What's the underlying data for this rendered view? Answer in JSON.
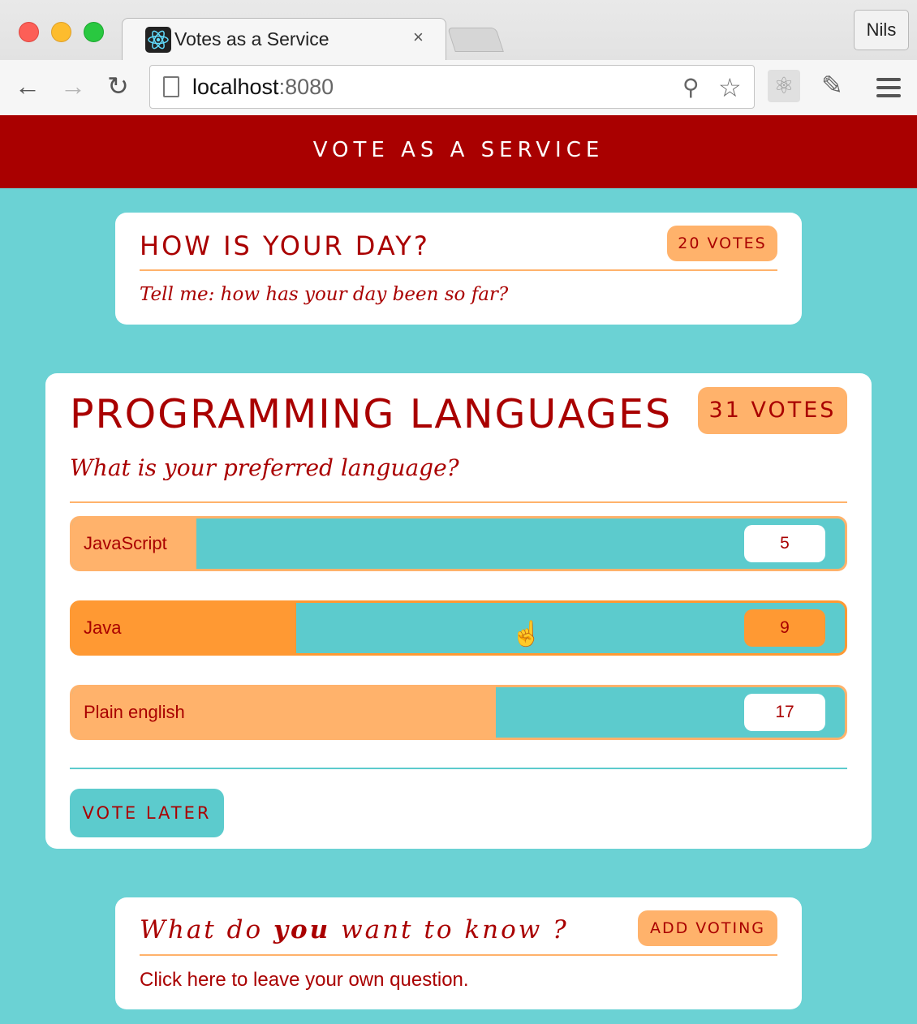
{
  "browser": {
    "tab_title": "Votes as a Service",
    "tab_close": "×",
    "profile": "Nils",
    "url_host": "localhost",
    "url_port": ":8080",
    "icons": [
      "back-icon",
      "forward-icon",
      "reload-icon",
      "page-icon",
      "zoom-icon",
      "star-icon",
      "react-devtools-icon",
      "color-picker-icon",
      "menu-icon"
    ]
  },
  "header": {
    "title": "VOTE AS A SERVICE"
  },
  "votes": [
    {
      "title": "HOW IS YOUR DAY?",
      "badge": "20 VOTES",
      "description": "Tell me: how has your day been so far?"
    },
    {
      "title": "PROGRAMMING LANGUAGES",
      "badge": "31 VOTES",
      "description": "What is your preferred language?",
      "choices": [
        {
          "label": "JavaScript",
          "count": "5",
          "share": 0.161
        },
        {
          "label": "Java",
          "count": "9",
          "share": 0.29
        },
        {
          "label": "Plain english",
          "count": "17",
          "share": 0.548
        }
      ],
      "vote_later": "VOTE LATER"
    }
  ],
  "ask": {
    "title_before": "What do ",
    "title_bold": "you",
    "title_after": " want to know ?",
    "button": "ADD VOTING",
    "description": "Click here to leave your own question."
  },
  "colors": {
    "header": "#a90000",
    "background": "#6bd2d4",
    "accent": "#ffb26b",
    "accent_active": "#ff9933",
    "bar": "#5ccbcd",
    "text": "#a90000"
  }
}
